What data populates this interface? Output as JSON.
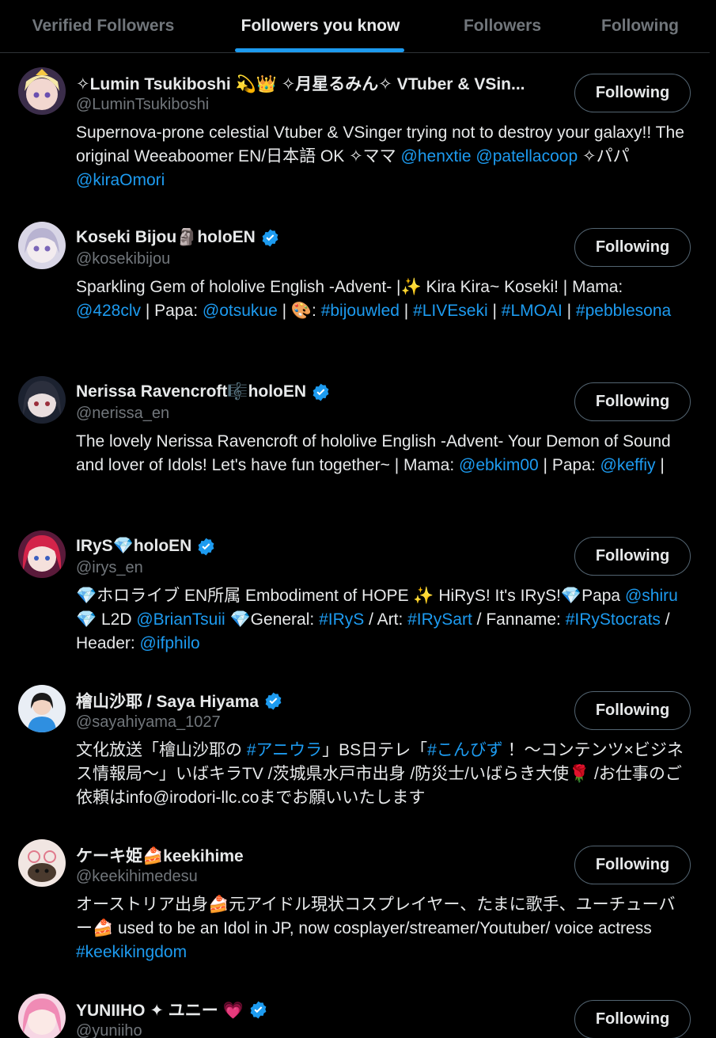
{
  "tabs": [
    {
      "label": "Verified Followers",
      "active": false
    },
    {
      "label": "Followers you know",
      "active": true
    },
    {
      "label": "Followers",
      "active": false
    },
    {
      "label": "Following",
      "active": false
    }
  ],
  "colors": {
    "accent": "#1d9bf0",
    "background": "#000000",
    "muted": "#71767b",
    "text": "#e7e9ea",
    "border": "#536471"
  },
  "button_label": "Following",
  "users": [
    {
      "name": "✧Lumin Tsukiboshi 💫👑 ✧月星るみん✧ VTuber & VSin...",
      "handle": "@LuminTsukiboshi",
      "verified": false,
      "bio": [
        {
          "t": "Supernova-prone celestial Vtuber & VSinger trying not to destroy your galaxy!! The original Weeaboomer EN/日本語 OK ✧ママ "
        },
        {
          "t": "@henxtie",
          "link": true
        },
        {
          "t": " "
        },
        {
          "t": "@patellacoop",
          "link": true
        },
        {
          "t": " ✧パパ "
        },
        {
          "t": "@kiraOmori",
          "link": true
        }
      ]
    },
    {
      "name": "Koseki Bijou🗿holoEN",
      "handle": "@kosekibijou",
      "verified": true,
      "bio": [
        {
          "t": "Sparkling Gem of hololive English -Advent- |✨ Kira Kira~ Koseki! | Mama: "
        },
        {
          "t": "@428clv",
          "link": true
        },
        {
          "t": " | Papa: "
        },
        {
          "t": "@otsukue",
          "link": true
        },
        {
          "t": " | 🎨: "
        },
        {
          "t": "#bijouwled",
          "link": true
        },
        {
          "t": " | "
        },
        {
          "t": "#LIVEseki",
          "link": true
        },
        {
          "t": " | "
        },
        {
          "t": "#LMOAI",
          "link": true
        },
        {
          "t": " | "
        },
        {
          "t": "#pebblesona",
          "link": true
        }
      ]
    },
    {
      "name": "Nerissa Ravencroft🎼holoEN",
      "handle": "@nerissa_en",
      "verified": true,
      "bio": [
        {
          "t": "The lovely Nerissa Ravencroft of hololive English -Advent- Your Demon of Sound and lover of Idols! Let's have fun together~ | Mama: "
        },
        {
          "t": "@ebkim00",
          "link": true
        },
        {
          "t": " | Papa: "
        },
        {
          "t": "@keffiy",
          "link": true
        },
        {
          "t": " |"
        }
      ]
    },
    {
      "name": "IRyS💎holoEN",
      "handle": "@irys_en",
      "verified": true,
      "bio": [
        {
          "t": "💎ホロライブ EN所属 Embodiment of HOPE ✨ HiRyS! It's IRyS!💎Papa "
        },
        {
          "t": "@shiru",
          "link": true
        },
        {
          "t": " 💎 L2D "
        },
        {
          "t": "@BrianTsuii",
          "link": true
        },
        {
          "t": " 💎General: "
        },
        {
          "t": "#IRyS",
          "link": true
        },
        {
          "t": " / Art: "
        },
        {
          "t": "#IRySart",
          "link": true
        },
        {
          "t": " / Fanname: "
        },
        {
          "t": "#IRyStocrats",
          "link": true
        },
        {
          "t": " / Header: "
        },
        {
          "t": "@ifphilo",
          "link": true
        }
      ]
    },
    {
      "name": "檜山沙耶 / Saya Hiyama",
      "handle": "@sayahiyama_1027",
      "verified": true,
      "bio": [
        {
          "t": "文化放送「檜山沙耶の "
        },
        {
          "t": "#アニウラ",
          "link": true
        },
        {
          "t": "」BS日テレ「"
        },
        {
          "t": "#こんびず",
          "link": true
        },
        {
          "t": " ！～コンテンツ×ビジネス情報局～」いばキラTV /茨城県水戸市出身 /防災士/いばらき大使🌹 /お仕事のご依頼はinfo@irodori-llc.coまでお願いいたします"
        }
      ]
    },
    {
      "name": "ケーキ姫🍰keekihime",
      "handle": "@keekihimedesu",
      "verified": false,
      "bio": [
        {
          "t": "オーストリア出身🍰元アイドル現状コスプレイヤー、たまに歌手、ユーチューバー🍰 used to be an Idol in JP, now cosplayer/streamer/Youtuber/ voice actress "
        },
        {
          "t": "#keekikingdom",
          "link": true
        }
      ]
    },
    {
      "name": "YUNIIHO ✦ ユニー 💗",
      "handle": "@yuniiho",
      "verified": true,
      "bio": []
    }
  ]
}
